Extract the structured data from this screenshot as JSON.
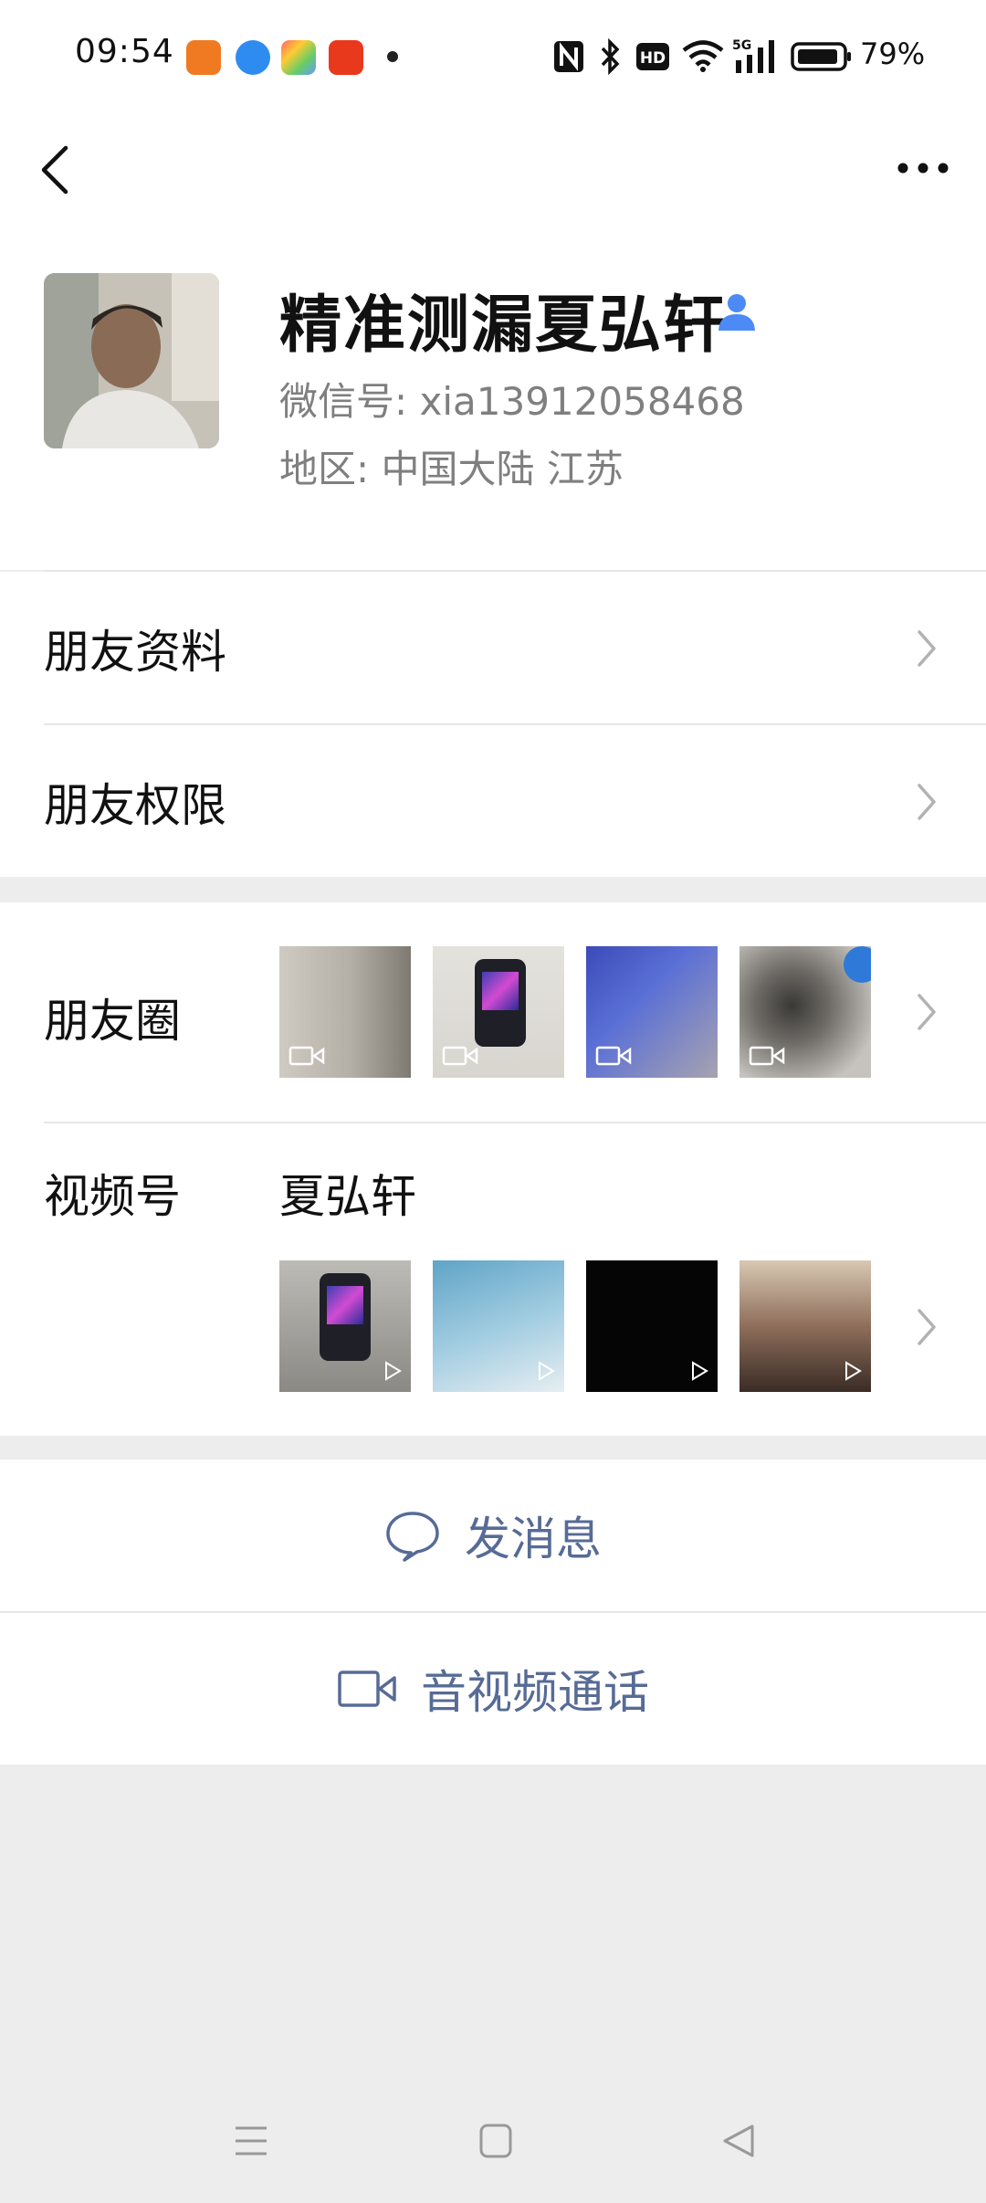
{
  "status_bar": {
    "time": "09:54",
    "battery": "79%",
    "network": "5G",
    "icons": [
      "nfc-icon",
      "bluetooth-icon",
      "hd-icon",
      "wifi-icon",
      "signal-icon",
      "battery-icon"
    ]
  },
  "nav": {
    "back_icon": "chevron-left-icon",
    "more_icon": "more-dots-icon"
  },
  "profile": {
    "name": "精准测漏夏弘轩",
    "wechat_id": "微信号: xia13912058468",
    "region": "地区: 中国大陆  江苏"
  },
  "menu": {
    "friend_profile": "朋友资料",
    "friend_permissions": "朋友权限"
  },
  "moments": {
    "label": "朋友圈",
    "thumb_colors": [
      "#b8b5ae",
      "#2a2a3e",
      "#4a5a9a",
      "#7d7d7d"
    ]
  },
  "channels": {
    "label": "视频号",
    "name": "夏弘轩",
    "thumb_colors": [
      "#8a8a8a",
      "#6fa9c6",
      "#050505",
      "#a37c66"
    ]
  },
  "actions": {
    "send_message": "发消息",
    "video_call": "音视频通话"
  },
  "colors": {
    "link": "#576b95",
    "background": "#ededed",
    "accent_icon": "#4c8bf5"
  }
}
